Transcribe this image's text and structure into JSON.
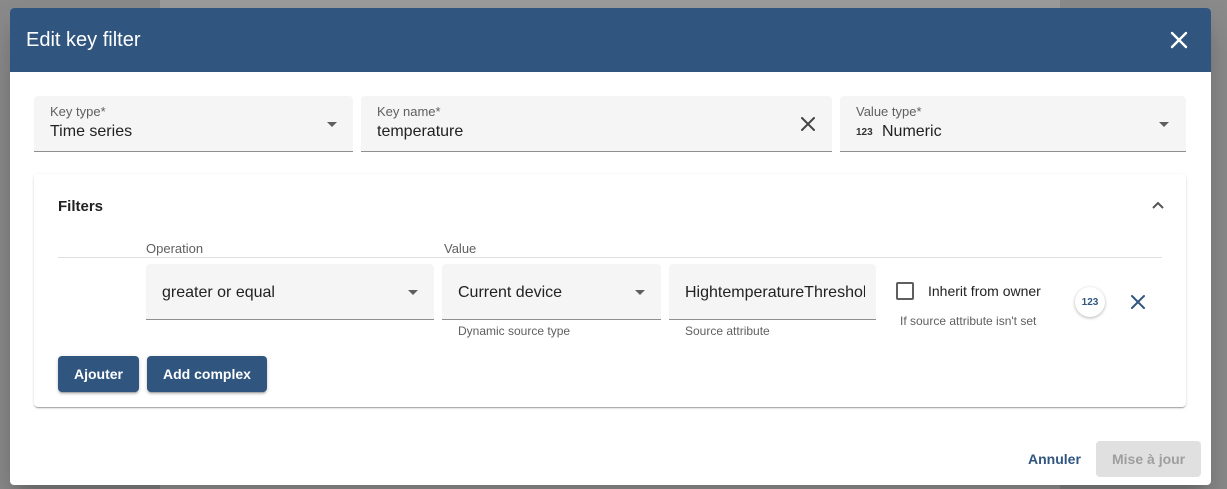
{
  "dialog": {
    "title": "Edit key filter",
    "close_icon": "close-icon"
  },
  "key_type": {
    "label": "Key type*",
    "value": "Time series"
  },
  "key_name": {
    "label": "Key name*",
    "value": "temperature"
  },
  "value_type": {
    "label": "Value type*",
    "icon_text": "123",
    "value": "Numeric"
  },
  "filters": {
    "title": "Filters",
    "operation_header": "Operation",
    "value_header": "Value",
    "row": {
      "operation": "greater or equal",
      "source_type": "Current device",
      "source_type_hint": "Dynamic source type",
      "source_attribute": "HightemperatureThreshold",
      "source_attribute_hint": "Source attribute",
      "inherit_label": "Inherit from owner",
      "inherit_hint": "If source attribute isn't set",
      "type_chip": "123"
    },
    "add_button": "Ajouter",
    "add_complex_button": "Add complex"
  },
  "footer": {
    "cancel": "Annuler",
    "update": "Mise à jour"
  },
  "colors": {
    "header": "#305680",
    "primary": "#305680"
  }
}
